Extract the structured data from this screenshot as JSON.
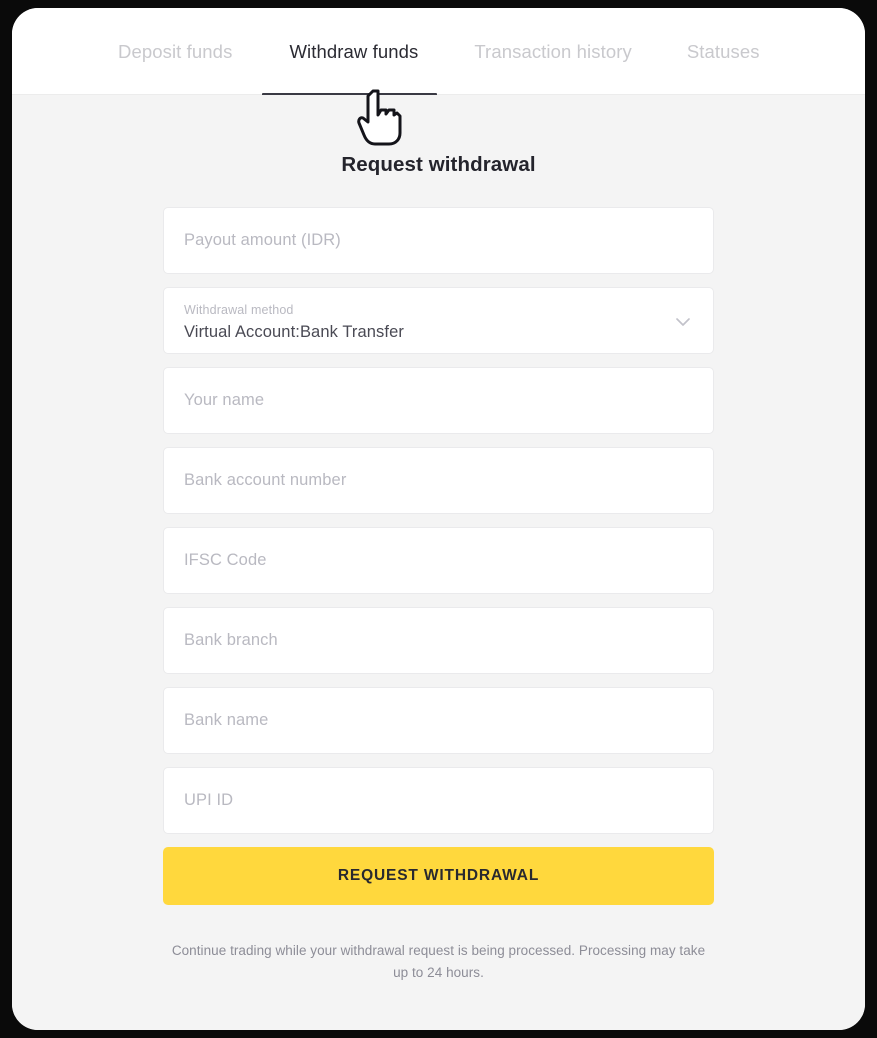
{
  "tabs": [
    {
      "label": "Deposit funds",
      "active": false
    },
    {
      "label": "Withdraw funds",
      "active": true
    },
    {
      "label": "Transaction history",
      "active": false
    },
    {
      "label": "Statuses",
      "active": false
    }
  ],
  "page": {
    "title": "Request withdrawal"
  },
  "form": {
    "amount": {
      "placeholder": "Payout amount (IDR)",
      "value": ""
    },
    "method": {
      "label": "Withdrawal method",
      "value": "Virtual Account:Bank Transfer",
      "icon": "chevron-down-icon"
    },
    "name": {
      "placeholder": "Your name",
      "value": ""
    },
    "account_number": {
      "placeholder": "Bank account number",
      "value": ""
    },
    "ifsc": {
      "placeholder": "IFSC Code",
      "value": ""
    },
    "branch": {
      "placeholder": "Bank branch",
      "value": ""
    },
    "bank_name": {
      "placeholder": "Bank name",
      "value": ""
    },
    "upi": {
      "placeholder": "UPI ID",
      "value": ""
    },
    "submit_label": "REQUEST WITHDRAWAL"
  },
  "footer": {
    "note": "Continue trading while your withdrawal request is being processed.  Processing may take up to 24 hours."
  },
  "colors": {
    "accent_yellow": "#ffd83d",
    "page_background": "#f4f4f4",
    "field_background": "#ffffff",
    "placeholder_text": "#b9b9c1",
    "active_tab_text": "#2b2b33",
    "inactive_tab_text": "#c9c9cd",
    "underline": "#3a3a44"
  },
  "cursor": {
    "icon": "pointing-hand-cursor"
  }
}
